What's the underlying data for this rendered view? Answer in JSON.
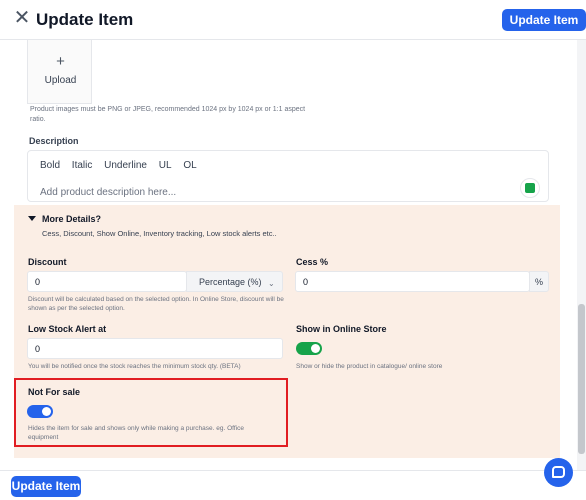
{
  "header": {
    "title": "Update Item",
    "close_icon": "close-icon",
    "update_button": "Update Item"
  },
  "upload": {
    "plus": "+",
    "label": "Upload",
    "hint": "Product images must be PNG or JPEG, recommended 1024 px by 1024 px or 1:1 aspect ratio."
  },
  "description": {
    "label": "Description",
    "toolbar": [
      "Bold",
      "Italic",
      "Underline",
      "UL",
      "OL"
    ],
    "placeholder": "Add product description here..."
  },
  "more_details": {
    "title": "More Details?",
    "subtitle": "Cess, Discount, Show Online, Inventory tracking, Low stock alerts etc..",
    "expanded": true,
    "background": "#fbeee5"
  },
  "discount": {
    "label": "Discount",
    "value": "0",
    "type": "Percentage (%)",
    "hint": "Discount will be calculated based on the selected option. In Online Store, discount will be shown as per the selected option."
  },
  "cess": {
    "label": "Cess %",
    "value": "0",
    "suffix": "%"
  },
  "low_stock": {
    "label": "Low Stock Alert at",
    "value": "0",
    "hint": "You will be notified once the stock reaches the minimum stock qty. (BETA)"
  },
  "show_online": {
    "label": "Show in Online Store",
    "enabled": true,
    "color": "#16a34a",
    "hint": "Show or hide the product in catalogue/ online store"
  },
  "not_for_sale": {
    "label": "Not For sale",
    "enabled": true,
    "color": "#2563eb",
    "hint": "Hides the item for sale and shows only while making a purchase. eg. Office equipment",
    "highlight_color": "#e11d22"
  },
  "footer": {
    "update_button": "Update Item"
  },
  "colors": {
    "primary": "#2563eb"
  }
}
